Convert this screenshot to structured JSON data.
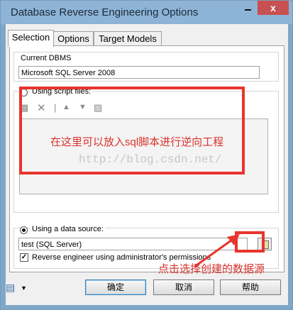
{
  "window": {
    "title": "Database Reverse Engineering Options",
    "close_glyph": "x"
  },
  "tabs": [
    {
      "label": "Selection",
      "active": true
    },
    {
      "label": "Options",
      "active": false
    },
    {
      "label": "Target Models",
      "active": false
    }
  ],
  "current_dbms": {
    "label": "Current DBMS",
    "value": "Microsoft SQL Server 2008"
  },
  "script_files": {
    "label": "Using script files:"
  },
  "data_source": {
    "label": "Using a data source:",
    "value": "test (SQL Server)",
    "admin_checkbox_label": "Reverse engineer using administrator's permissions",
    "admin_checked": true
  },
  "annotations": {
    "script_note": "在这里可以放入sql脚本进行逆向工程",
    "watermark": "http://blog.csdn.net/",
    "datasource_note": "点击选择创建的数据源",
    "color": "#e8352d"
  },
  "buttons": {
    "ok": "确定",
    "cancel": "取消",
    "help": "帮助"
  },
  "icons": {
    "toolbar": [
      "add-file-icon",
      "delete-icon",
      "move-up-icon",
      "move-down-icon",
      "properties-icon"
    ],
    "bottom_left": "tools-menu-icon",
    "browse": "browse-datasource-icon"
  }
}
